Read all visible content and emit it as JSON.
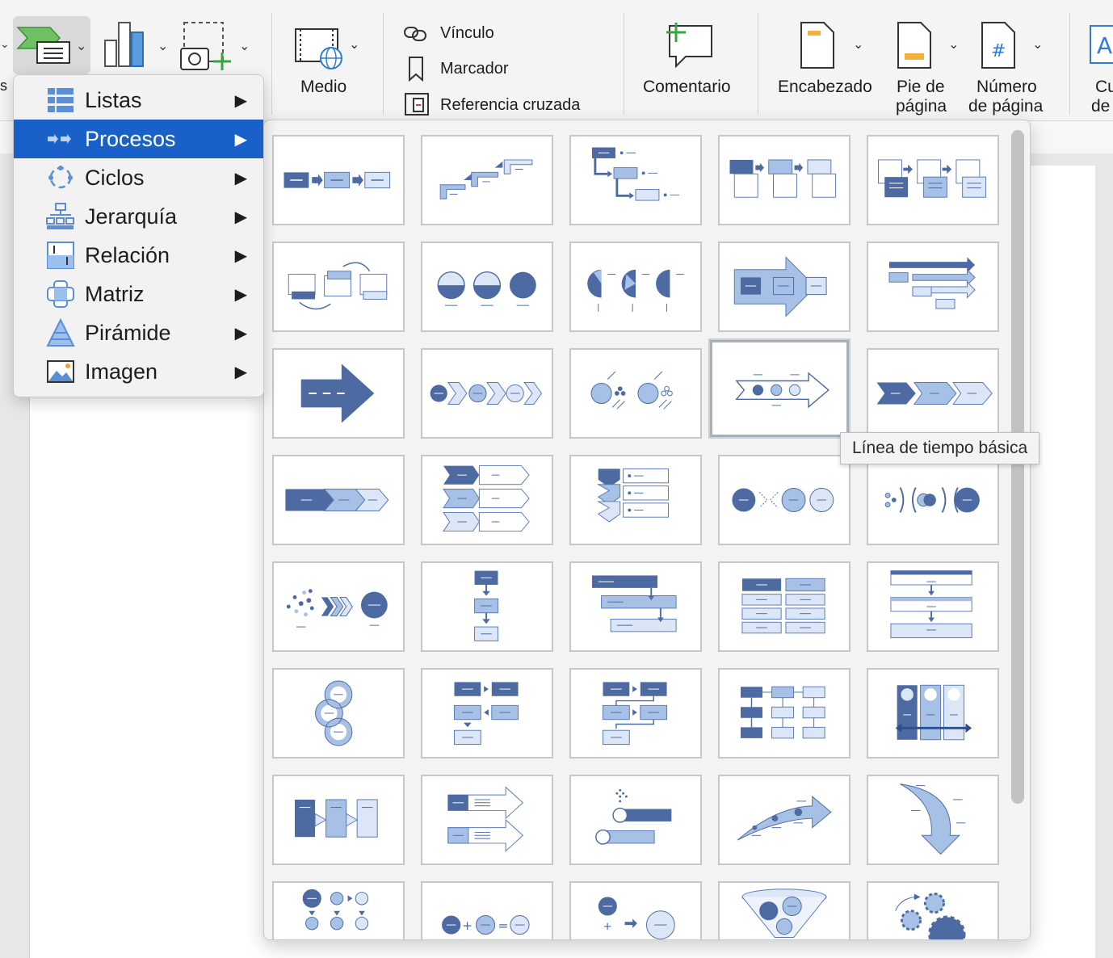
{
  "ribbon": {
    "medio": "Medio",
    "vinculo": "Vínculo",
    "marcador": "Marcador",
    "referencia": "Referencia cruzada",
    "comentario": "Comentario",
    "encabezado": "Encabezado",
    "pie_line1": "Pie de",
    "pie_line2": "página",
    "numero_line1": "Número",
    "numero_line2": "de página",
    "cut_line1": "Cu",
    "cut_line2": "de",
    "left_fragment": "s"
  },
  "category_menu": {
    "items": [
      {
        "label": "Listas",
        "active": false
      },
      {
        "label": "Procesos",
        "active": true
      },
      {
        "label": "Ciclos",
        "active": false
      },
      {
        "label": "Jerarquía",
        "active": false
      },
      {
        "label": "Relación",
        "active": false
      },
      {
        "label": "Matriz",
        "active": false
      },
      {
        "label": "Pirámide",
        "active": false
      },
      {
        "label": "Imagen",
        "active": false
      }
    ],
    "arrow": "▶"
  },
  "tooltip": "Línea de tiempo básica",
  "colors": {
    "dark": "#4e6aa2",
    "mid": "#a7c0e6",
    "light": "#dbe6f6",
    "stroke": "#5a79b5",
    "menu_active": "#1960c8"
  }
}
